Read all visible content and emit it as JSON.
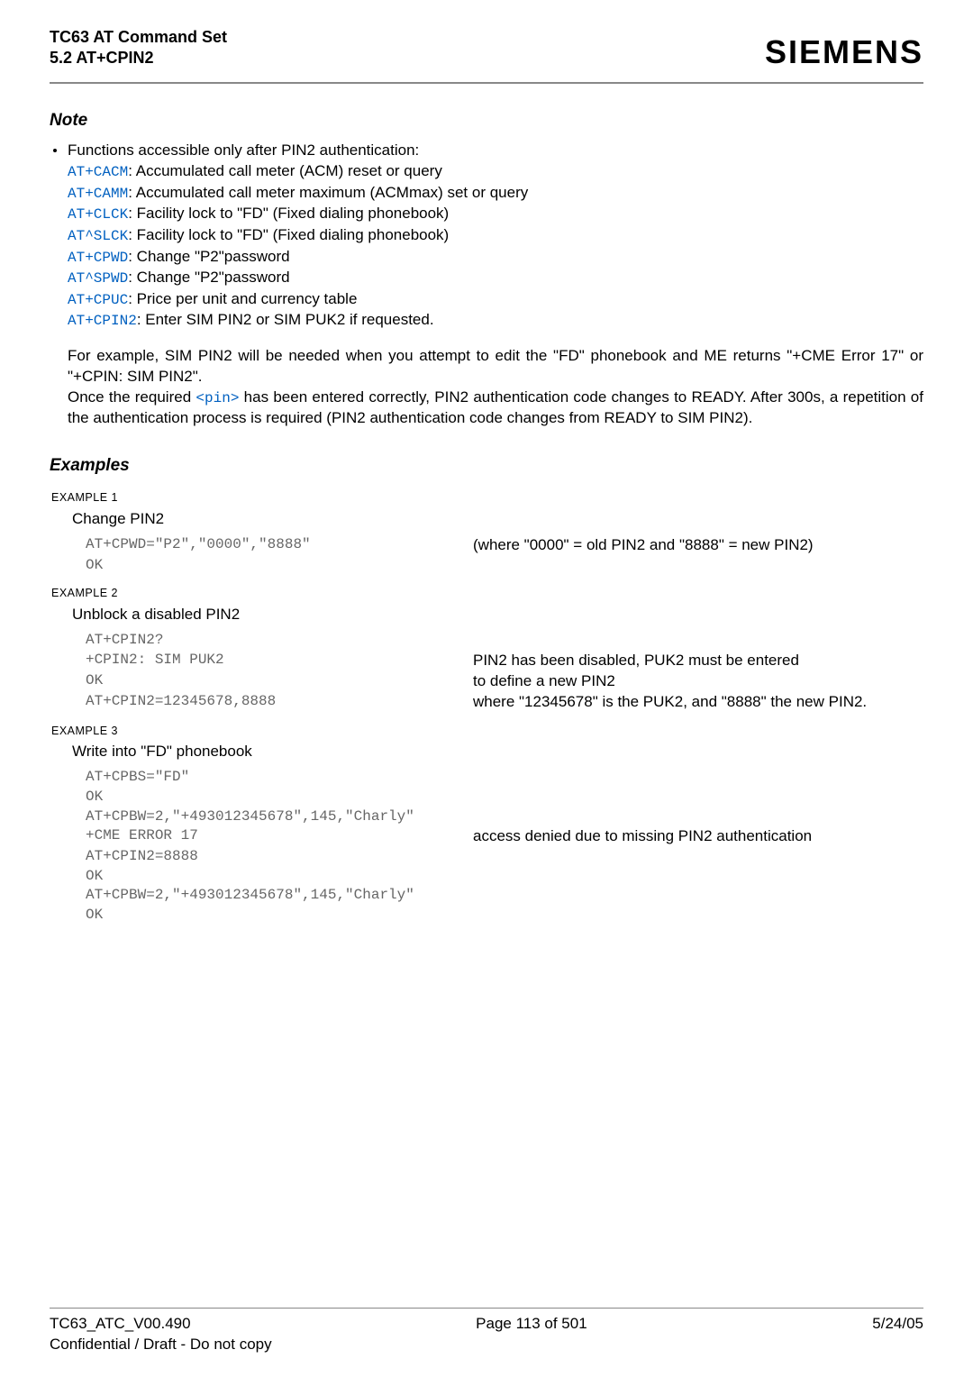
{
  "header": {
    "title_line1": "TC63 AT Command Set",
    "title_line2": "5.2 AT+CPIN2",
    "brand": "SIEMENS"
  },
  "note": {
    "heading": "Note",
    "intro": "Functions accessible only after PIN2 authentication:",
    "lines": [
      {
        "cmd": "AT+CACM",
        "desc": ": Accumulated call meter (ACM) reset or query"
      },
      {
        "cmd": "AT+CAMM",
        "desc": ": Accumulated call meter maximum (ACMmax) set or query"
      },
      {
        "cmd": "AT+CLCK",
        "desc": ": Facility lock to \"FD\" (Fixed dialing phonebook)"
      },
      {
        "cmd": "AT^SLCK",
        "desc": ": Facility lock to \"FD\" (Fixed dialing phonebook)"
      },
      {
        "cmd": "AT+CPWD",
        "desc": ": Change \"P2\"password"
      },
      {
        "cmd": "AT^SPWD",
        "desc": ": Change \"P2\"password"
      },
      {
        "cmd": "AT+CPUC",
        "desc": ": Price per unit and currency table"
      },
      {
        "cmd": "AT+CPIN2",
        "desc": ": Enter SIM PIN2 or SIM PUK2 if requested."
      }
    ],
    "para1": "For example, SIM PIN2 will be needed when you attempt to edit the \"FD\" phonebook and ME returns \"+CME Error 17\" or \"+CPIN: SIM PIN2\".",
    "para2_a": "Once the required ",
    "para2_link": "<pin>",
    "para2_b": " has been entered correctly, PIN2 authentication code changes to READY. After 300s, a repetition of the authentication process is required (PIN2 authentication code changes from READY to SIM PIN2)."
  },
  "examples": {
    "heading": "Examples",
    "ex1": {
      "label": "EXAMPLE 1",
      "title": "Change PIN2",
      "cmd": "AT+CPWD=\"P2\",\"0000\",\"8888\"",
      "ok": "OK",
      "right": "(where \"0000\" = old PIN2 and \"8888\" = new PIN2)"
    },
    "ex2": {
      "label": "EXAMPLE 2",
      "title": "Unblock a disabled PIN2",
      "l1": "AT+CPIN2?",
      "l2": "+CPIN2: SIM PUK2",
      "l3": "OK",
      "l4": "AT+CPIN2=12345678,8888",
      "r2": "PIN2 has been disabled, PUK2 must be entered",
      "r3": "to define a new PIN2",
      "r4": "where \"12345678\" is the PUK2, and \"8888\" the new PIN2."
    },
    "ex3": {
      "label": "EXAMPLE 3",
      "title": "Write into \"FD\" phonebook",
      "l1": "AT+CPBS=\"FD\"",
      "l2": "OK",
      "l3": "AT+CPBW=2,\"+493012345678\",145,\"Charly\"",
      "l4": "+CME ERROR 17",
      "l5": "AT+CPIN2=8888",
      "l6": "OK",
      "l7": "AT+CPBW=2,\"+493012345678\",145,\"Charly\"",
      "l8": "OK",
      "r4": "access denied due to missing PIN2 authentication"
    }
  },
  "footer": {
    "left1": "TC63_ATC_V00.490",
    "left2": "Confidential / Draft - Do not copy",
    "center": "Page 113 of 501",
    "right": "5/24/05"
  }
}
